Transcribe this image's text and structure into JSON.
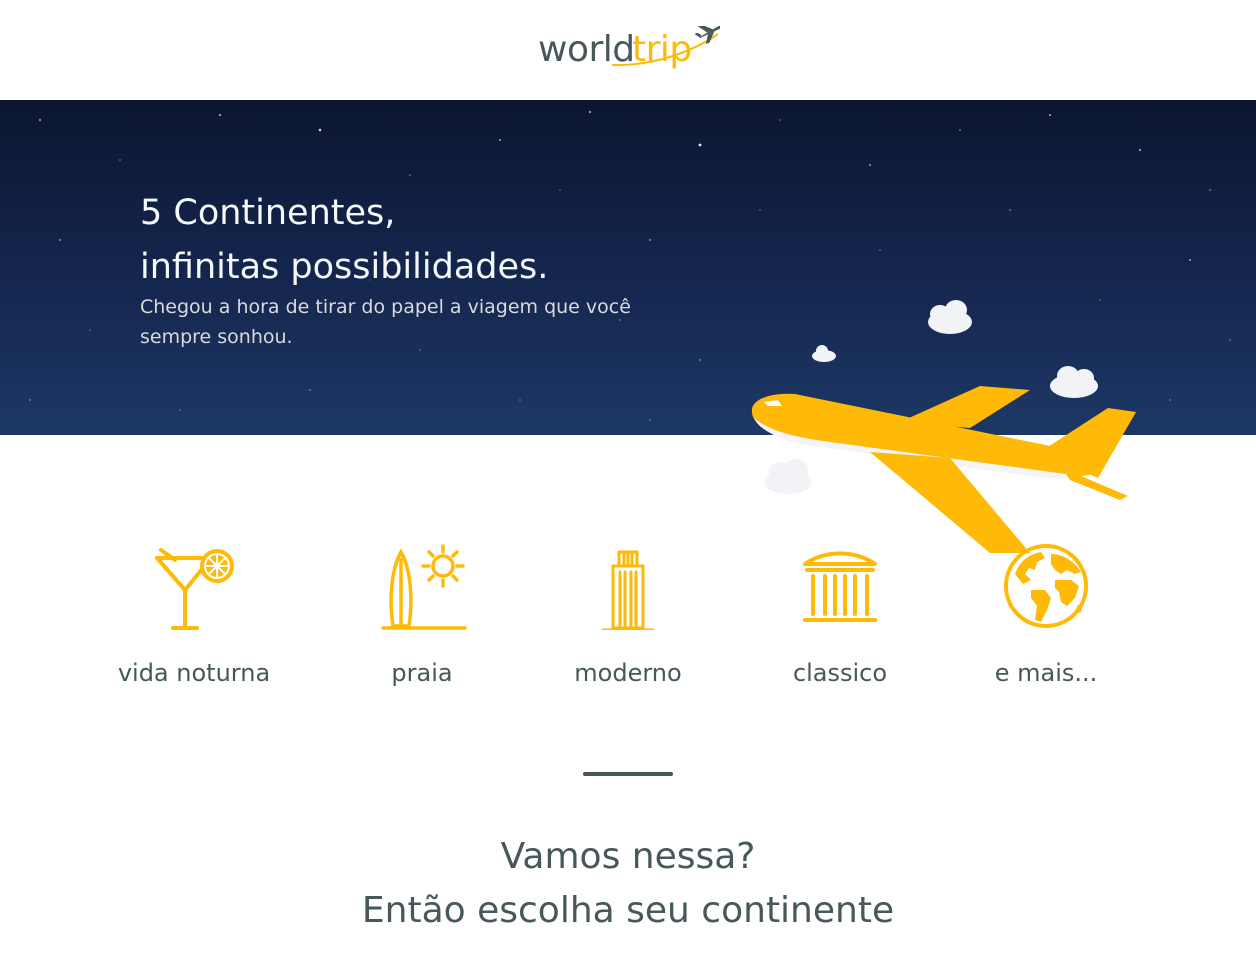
{
  "header": {
    "logo_world": "world",
    "logo_trip": "trip",
    "logo_icon": "airplane-icon"
  },
  "banner": {
    "title_line1": "5 Continentes,",
    "title_line2": "infinitas possibilidades.",
    "subtitle": "Chegou a hora de tirar do papel a viagem que você sempre sonhou.",
    "illustration": "airplane-with-clouds"
  },
  "travel_types": [
    {
      "label": "vida noturna",
      "icon": "cocktail-icon"
    },
    {
      "label": "praia",
      "icon": "surfboard-sun-icon"
    },
    {
      "label": "moderno",
      "icon": "skyscraper-icon"
    },
    {
      "label": "classico",
      "icon": "museum-icon"
    },
    {
      "label": "e mais...",
      "icon": "globe-icon"
    }
  ],
  "cta": {
    "line1": "Vamos nessa?",
    "line2": "Então escolha seu continente"
  },
  "colors": {
    "accent": "#FFBA08",
    "text": "#47585B",
    "banner_dark": "#0c1630",
    "banner_light": "#1d3866",
    "light_text": "#F5F8FA"
  }
}
